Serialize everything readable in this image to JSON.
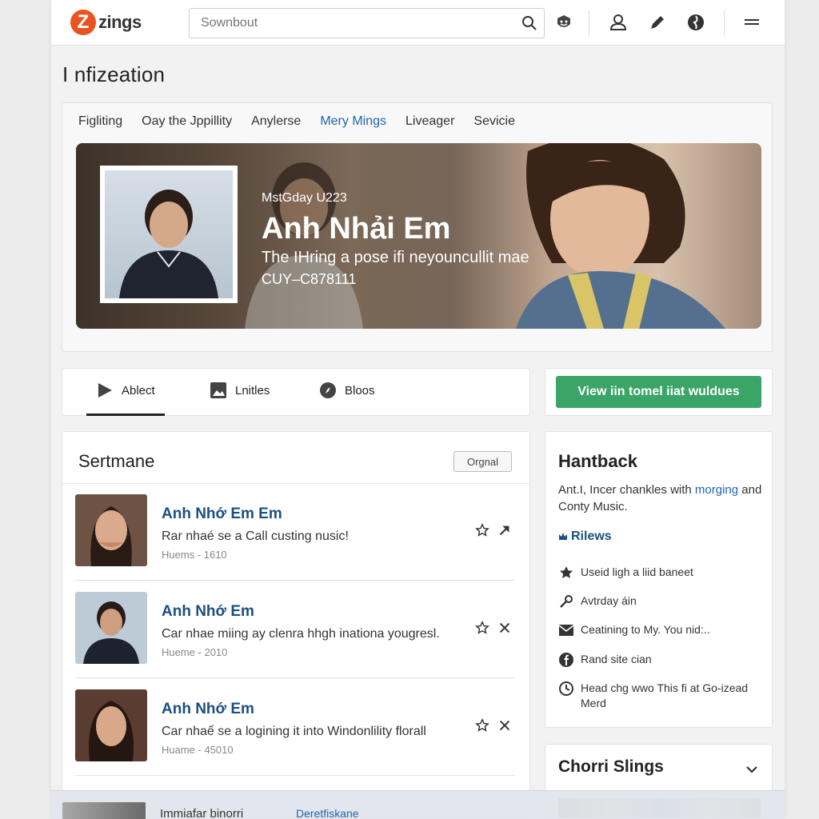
{
  "app": {
    "logo_letter": "Z",
    "logo_text": "zings"
  },
  "search": {
    "placeholder": "Sownbout"
  },
  "page": {
    "title": "I nfizeation"
  },
  "hero": {
    "tabs": [
      {
        "label": "Figliting",
        "active": false
      },
      {
        "label": "Oay the Jppillity",
        "active": false
      },
      {
        "label": "Anylerse",
        "active": false
      },
      {
        "label": "Mery Mings",
        "active": true
      },
      {
        "label": "Liveager",
        "active": false
      },
      {
        "label": "Sevicie",
        "active": false
      }
    ],
    "kicker": "MstGday U223",
    "title": "Anh Nhải Em",
    "subtitle": "The IHring a pose ifi neyouncullit mae",
    "code": "CUY–C878111"
  },
  "media_tabs": [
    {
      "label": "Ablect",
      "icon": "play-icon"
    },
    {
      "label": "Lnitles",
      "icon": "image-icon"
    },
    {
      "label": "Bloos",
      "icon": "compass-icon"
    }
  ],
  "view_button": {
    "label": "View iin tomel iiat wuldues"
  },
  "list": {
    "title": "Sertmane",
    "original_label": "Orgnal",
    "rows": [
      {
        "title": "Anh Nhớ Em Em",
        "desc": "Rar nhaé se a Call custing nusic!",
        "meta": "Huems - 1610",
        "action1": "star-icon",
        "action2": "share-arrow-icon"
      },
      {
        "title": "Anh Nhớ Em",
        "desc": "Car nhae miing ay clenra hhgh inationa yougresl.",
        "meta": "Hueme - 2010",
        "action1": "star-icon",
        "action2": "close-icon"
      },
      {
        "title": "Anh Nhớ Em",
        "desc": "Car nhaế se a logining it into Windonlility florall",
        "meta": "Huame - 45010",
        "action1": "star-icon",
        "action2": "close-icon"
      }
    ]
  },
  "sidebar": {
    "title": "Hantback",
    "desc_prefix": "Ant.I, Incer chankles with ",
    "desc_link": "morging",
    "desc_suffix": " and Conty Music.",
    "subheading": "Rilews",
    "items": [
      {
        "label": "Useid ligh a liid baneet",
        "icon": "star-icon"
      },
      {
        "label": "Avtrday áin",
        "icon": "wrench-icon"
      },
      {
        "label": "Ceatining to My. You nid:..",
        "icon": "mail-icon"
      },
      {
        "label": "Rand site cian",
        "icon": "facebook-icon"
      },
      {
        "label": "Head chg wwo This fi at Go-izead Merd",
        "icon": "clock-icon"
      }
    ]
  },
  "sidebar2": {
    "title": "Chorri Slings"
  },
  "bottom_bar": {
    "text": "Immiafar binorri",
    "link": "Deretfiskane"
  },
  "colors": {
    "brand": "#e8531f",
    "accent_blue": "#1f64b5",
    "title_blue": "#1b4f80",
    "button_green": "#3aa566"
  }
}
